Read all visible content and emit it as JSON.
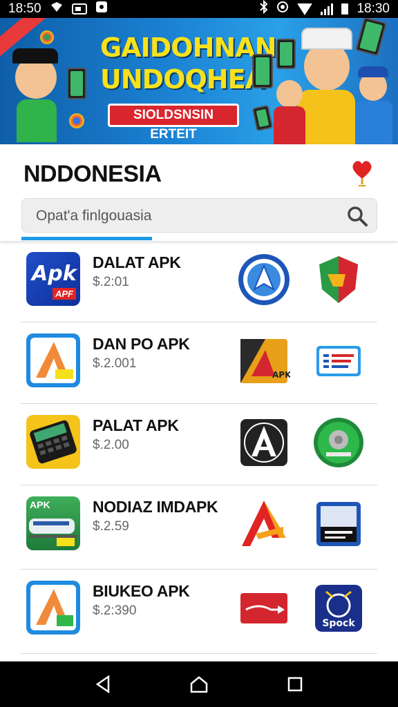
{
  "status_bar": {
    "time_left": "18:50",
    "time_right": "18:30"
  },
  "banner": {
    "title_line1": "GAIDOHNAN",
    "title_line2": "UNDOQHEA",
    "subtitle": "SIOLDSNSIN ERTEIT"
  },
  "header": {
    "title": "NDDONESIA",
    "search_placeholder": "Opat'a finlgouasia"
  },
  "apps": [
    {
      "name": "DALAT APK",
      "price": "$.2:01",
      "icon_text": "Apk",
      "icon_sub": "APF"
    },
    {
      "name": "DAN PO APK",
      "price": "$.2.001",
      "icon_text": "",
      "icon_sub": ""
    },
    {
      "name": "PALAT APK",
      "price": "$.2.00",
      "icon_text": "",
      "icon_sub": ""
    },
    {
      "name": "NODIAZ IMDAPK",
      "price": "$.2.59",
      "icon_text": "APK",
      "icon_sub": ""
    },
    {
      "name": "BIUKEO APK",
      "price": "$.2:390",
      "icon_text": "",
      "icon_sub": ""
    }
  ],
  "thumb_labels": {
    "spock": "Spock",
    "apk": "APK"
  },
  "colors": {
    "accent": "#1e9be6",
    "banner_title": "#f7e11c",
    "banner_sub_bg": "#d9262e"
  }
}
